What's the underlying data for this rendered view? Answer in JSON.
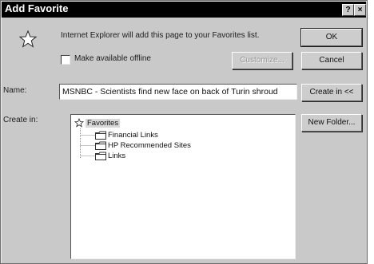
{
  "dialog": {
    "title": "Add Favorite",
    "help_glyph": "?",
    "close_glyph": "×"
  },
  "info": {
    "text": "Internet Explorer will add this page to your Favorites list.",
    "icon": "star-icon"
  },
  "offline": {
    "label": "Make available offline",
    "checked": false
  },
  "buttons": {
    "customize": "Customize...",
    "ok": "OK",
    "cancel": "Cancel",
    "create_in": "Create in <<",
    "new_folder": "New Folder..."
  },
  "name": {
    "label": "Name:",
    "value": "MSNBC - Scientists find new face on back of Turin shroud"
  },
  "create_in": {
    "label": "Create in:",
    "root": "Favorites",
    "folders": [
      "Financial Links",
      "HP Recommended Sites",
      "Links"
    ]
  },
  "colors": {
    "dialog_bg": "#c9c9c9",
    "titlebar": "#000000",
    "field_bg": "#ffffff"
  }
}
